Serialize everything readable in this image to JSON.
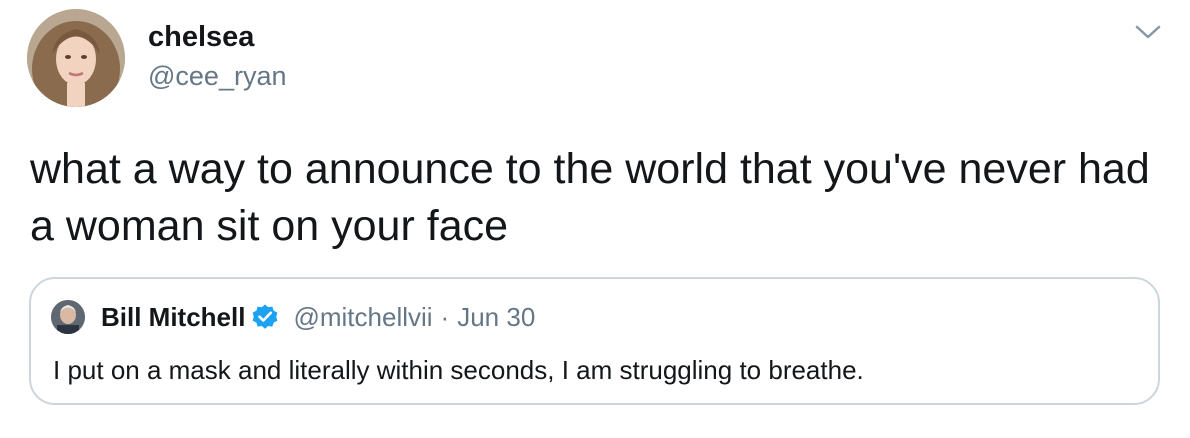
{
  "tweet": {
    "author": {
      "name": "chelsea",
      "handle": "@cee_ryan"
    },
    "text": "what a way to announce to the world that you've never had a woman sit on your face",
    "menu_icon": "chevron-down-icon"
  },
  "quoted_tweet": {
    "author": {
      "name": "Bill Mitchell",
      "handle": "@mitchellvii",
      "verified": true
    },
    "separator": "·",
    "date": "Jun 30",
    "text": "I put on a mask and literally within seconds, I am struggling to breathe."
  },
  "colors": {
    "primary_text": "#14171a",
    "secondary_text": "#657786",
    "border": "#ccd6dd",
    "verified_blue": "#1da1f2"
  }
}
